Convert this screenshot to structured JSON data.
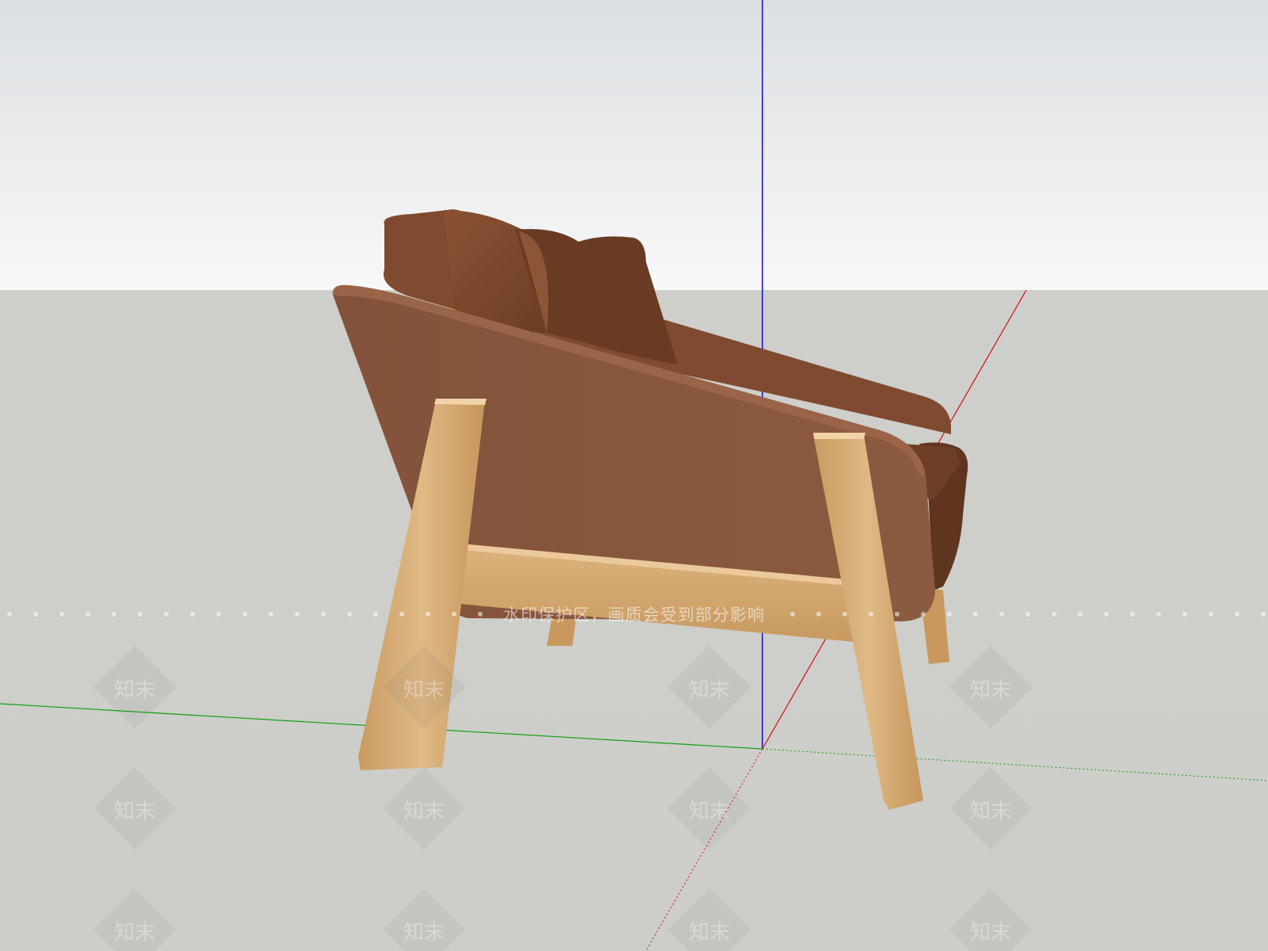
{
  "app": {
    "type": "3d-modeling-viewport",
    "subject": "armchair model"
  },
  "colors": {
    "sky_top": "#dfe3e6",
    "sky_bottom": "#f6f7f7",
    "ground": "#cfcfcb",
    "axis_blue": "#1a1ad6",
    "axis_red": "#d01010",
    "axis_green": "#10a010",
    "upholstery": "#8a5539",
    "upholstery_dark": "#6a3c25",
    "wood": "#d8b07a",
    "wood_dark": "#b9894f"
  },
  "watermark": {
    "banner_text": "水印保护区，画质会受到部分影响",
    "logo_text": "知末"
  },
  "icons": {
    "watermark_logo": "zhimo-diamond-logo-icon"
  }
}
